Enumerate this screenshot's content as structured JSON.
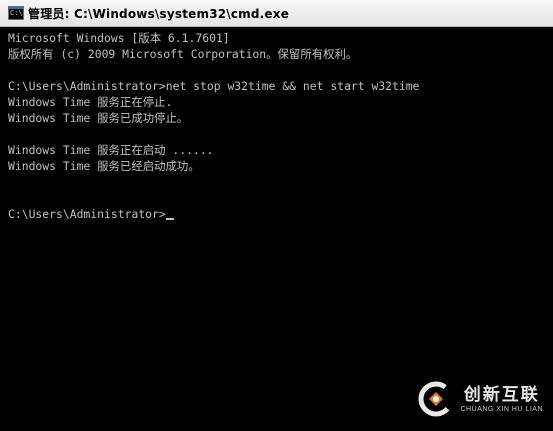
{
  "window": {
    "title": "管理员: C:\\Windows\\system32\\cmd.exe",
    "icon": "cmd-icon",
    "icon_glyph": "C:\\"
  },
  "console": {
    "lines": [
      "Microsoft Windows [版本 6.1.7601]",
      "版权所有 (c) 2009 Microsoft Corporation。保留所有权利。",
      "",
      "C:\\Users\\Administrator>net stop w32time && net start w32time",
      "Windows Time 服务正在停止.",
      "Windows Time 服务已成功停止。",
      "",
      "Windows Time 服务正在启动 ......",
      "Windows Time 服务已经启动成功。",
      "",
      "",
      "C:\\Users\\Administrator>"
    ]
  },
  "watermark": {
    "brand_cn": "创新互联",
    "brand_en": "CHUANG XIN HU LIAN",
    "logo_icon": "swirl-logo-icon"
  },
  "colors": {
    "console_bg": "#000000",
    "console_text": "#c0c0c0"
  }
}
